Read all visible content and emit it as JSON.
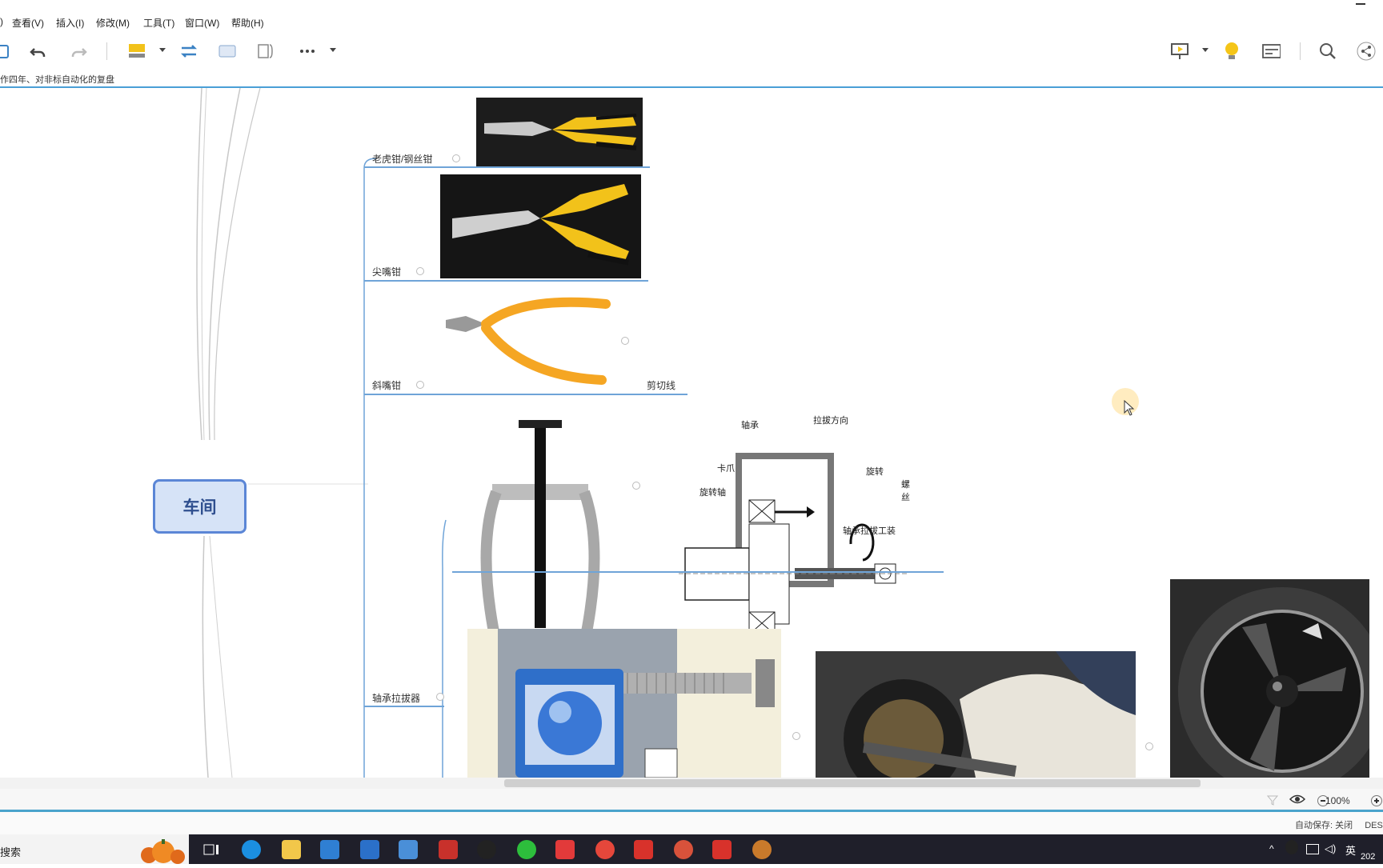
{
  "menu": {
    "items": [
      "查看(V)",
      "插入(I)",
      "修改(M)",
      "工具(T)",
      "窗口(W)",
      "帮助(H)"
    ]
  },
  "document": {
    "title": "作四年、对非标自动化的复盘"
  },
  "mindmap": {
    "central": "车间",
    "branches": [
      {
        "label": "老虎钳/钢丝钳"
      },
      {
        "label": "尖嘴钳"
      },
      {
        "label": "斜嘴钳",
        "note": "剪切线"
      },
      {
        "label": "轴承拉拔器"
      }
    ],
    "diagram": {
      "bearing": "轴承",
      "pull_direction": "拉拔方向",
      "claw": "卡爪",
      "rotate": "旋转",
      "shaft": "旋转轴",
      "screw": "螺丝",
      "tool": "轴承拉拔工装"
    }
  },
  "status": {
    "zoom": "100%",
    "autosave": "自动保存: 关闭",
    "desktop": "DES"
  },
  "taskbar": {
    "search": "搜索",
    "lang": "英",
    "year": "202"
  },
  "icons": {
    "undo": "undo-icon",
    "redo": "redo-icon",
    "search": "search-icon",
    "share": "share-icon",
    "bulb": "lightbulb-icon"
  },
  "colors": {
    "accent": "#4a9fd6",
    "central_node_bg": "#d6e3f7",
    "central_node_border": "#5b86d6",
    "plier_yellow": "#f2c21a",
    "plier_orange": "#f5a623"
  }
}
